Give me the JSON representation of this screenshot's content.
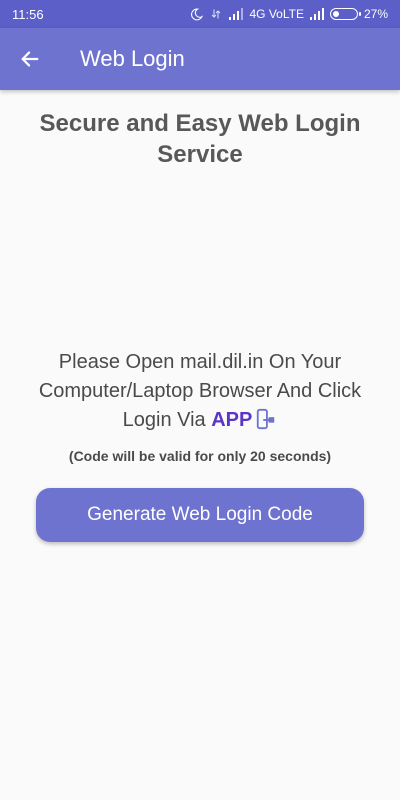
{
  "status_bar": {
    "time": "11:56",
    "network": "4G VoLTE",
    "battery": "27%",
    "battery_level": 0.27,
    "icons": [
      "moon-icon",
      "data-arrows-icon",
      "signal-icon",
      "signal-icon",
      "battery-icon"
    ]
  },
  "app_bar": {
    "title": "Web Login",
    "back_icon": "arrow-left-icon"
  },
  "content": {
    "headline": "Secure and Easy Web Login Service",
    "instruction_main": "Please Open mail.dil.in On Your Computer/Laptop Browser And Click Login Via ",
    "instruction_link": "APP",
    "instruction_icon": "phone-transfer-icon",
    "validity_note": "(Code will be valid for only 20 seconds)",
    "generate_button_label": "Generate Web Login Code"
  },
  "colors": {
    "status_bar": "#5b5fc7",
    "app_bar": "#6f73d0",
    "accent_text": "#5b36c6",
    "background": "#fafafa"
  }
}
